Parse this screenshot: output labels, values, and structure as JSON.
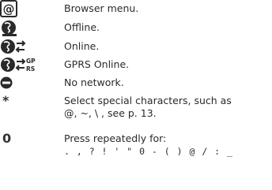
{
  "entries": [
    {
      "icon": "browser-menu-icon",
      "text": "Browser menu."
    },
    {
      "icon": "offline-globe-icon",
      "text": "Offline."
    },
    {
      "icon": "online-globe-icon",
      "text": "Online."
    },
    {
      "icon": "gprs-online-globe-icon",
      "icon_text_top": "GP",
      "icon_text_bottom": "RS",
      "text": "GPRS Online."
    },
    {
      "icon": "no-network-icon",
      "text": "No network."
    },
    {
      "key": "*",
      "text_line1": "Select special characters, such as",
      "text_line2": "@, ~, \\ , see p. 13."
    },
    {
      "key": "0",
      "text_line1": "Press repeatedly for:",
      "text_line2": ". , ? ! ' \" 0 - ( ) @ / : _"
    }
  ],
  "colors": {
    "icon_fill": "#2a2a2a",
    "text": "#222222",
    "background": "#ffffff"
  }
}
